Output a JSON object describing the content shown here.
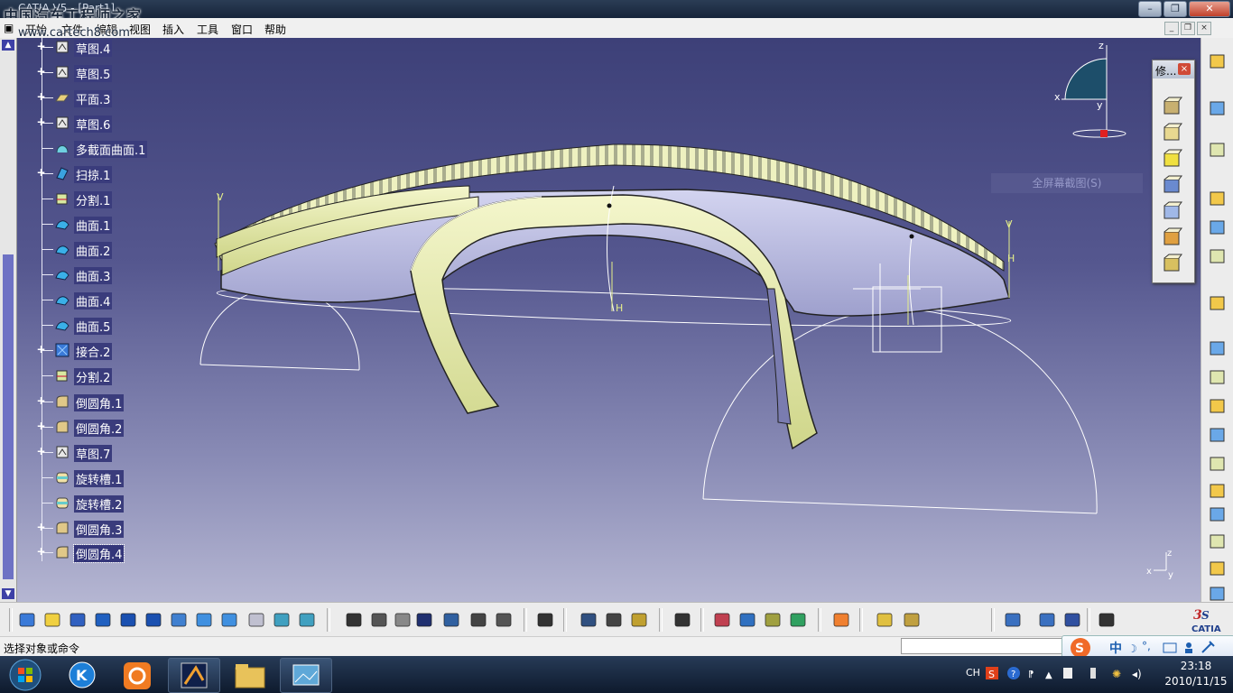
{
  "window": {
    "title": "CATIA V5 - [Part1]",
    "watermark": "中国汽车工程师之家",
    "watermark_url": "www.cartech8.com",
    "controls": [
      "minimize",
      "restore",
      "close"
    ]
  },
  "menubar": {
    "items": [
      "开始",
      "文件",
      "编辑",
      "视图",
      "插入",
      "工具",
      "窗口",
      "帮助"
    ]
  },
  "tree": {
    "items": [
      {
        "label": "草图.4",
        "icon": "sketch-icon",
        "expandable": true
      },
      {
        "label": "草图.5",
        "icon": "sketch-icon",
        "expandable": true
      },
      {
        "label": "平面.3",
        "icon": "plane-icon",
        "expandable": true
      },
      {
        "label": "草图.6",
        "icon": "sketch-icon",
        "expandable": true
      },
      {
        "label": "多截面曲面.1",
        "icon": "multi-section-surface-icon",
        "expandable": false
      },
      {
        "label": "扫掠.1",
        "icon": "sweep-icon",
        "expandable": true
      },
      {
        "label": "分割.1",
        "icon": "split-icon",
        "expandable": false
      },
      {
        "label": "曲面.1",
        "icon": "surface-icon",
        "expandable": false
      },
      {
        "label": "曲面.2",
        "icon": "surface-icon",
        "expandable": false
      },
      {
        "label": "曲面.3",
        "icon": "surface-icon",
        "expandable": false
      },
      {
        "label": "曲面.4",
        "icon": "surface-icon",
        "expandable": false
      },
      {
        "label": "曲面.5",
        "icon": "surface-icon",
        "expandable": false
      },
      {
        "label": "接合.2",
        "icon": "join-icon",
        "expandable": true
      },
      {
        "label": "分割.2",
        "icon": "split-icon",
        "expandable": false
      },
      {
        "label": "倒圆角.1",
        "icon": "fillet-icon",
        "expandable": true
      },
      {
        "label": "倒圆角.2",
        "icon": "fillet-icon",
        "expandable": true
      },
      {
        "label": "草图.7",
        "icon": "sketch-icon",
        "expandable": true
      },
      {
        "label": "旋转槽.1",
        "icon": "groove-icon",
        "expandable": false
      },
      {
        "label": "旋转槽.2",
        "icon": "groove-icon",
        "expandable": false
      },
      {
        "label": "倒圆角.3",
        "icon": "fillet-icon",
        "expandable": true
      },
      {
        "label": "倒圆角.4",
        "icon": "fillet-icon",
        "expandable": true,
        "selected": true
      }
    ]
  },
  "floating_toolbar": {
    "title": "修...",
    "tools": [
      "draft-icon",
      "shell-icon",
      "thickness-icon",
      "thread-icon",
      "remove-face-icon",
      "replace-face-icon",
      "thickness-surface-icon"
    ]
  },
  "viewport": {
    "compass_labels": {
      "z": "z",
      "x": "x",
      "y": "y"
    },
    "axis_labels": {
      "z": "z",
      "x": "x",
      "y": "y"
    },
    "screen_capture_hint": "全屏幕截图(S)",
    "dimension_labels": [
      "H",
      "V",
      "H",
      "V"
    ]
  },
  "bottom_toolbar": {
    "tools": [
      "fly-mode-icon",
      "fit-all-icon",
      "pan-icon",
      "rotate-icon",
      "zoom-in-icon",
      "zoom-out-icon",
      "normal-view-icon",
      "multi-view-icon",
      "iso-view-icon",
      "shading-icon",
      "hide-show-icon",
      "swap-space-icon",
      "formula-icon",
      "comment-icon",
      "reference-icon",
      "table-icon",
      "knowledge-icon",
      "catalog-icon",
      "expose-icon",
      "update-icon",
      "measure-icon",
      "inertia-icon",
      "material-icon",
      "capture-icon",
      "apply-material-icon",
      "texture-icon",
      "environment-icon",
      "layer-icon",
      "paint-icon",
      "axis-icon",
      "sketch-icon",
      "plane-icon",
      "analysis-icon",
      "grid-icon",
      "snap-icon"
    ]
  },
  "statusbar": {
    "status_text": "选择对象或命令",
    "command_input": ""
  },
  "ime": {
    "mode": "中",
    "items": [
      "sogou-icon",
      "moon-icon",
      "punctuation-icon",
      "keyboard-icon",
      "user-icon",
      "wrench-icon"
    ]
  },
  "taskbar": {
    "tray_lang": "CH",
    "time": "23:18",
    "date": "2010/11/15"
  },
  "brand": {
    "logo": "CATIA"
  },
  "colors": {
    "viewport_top": "#3d4078",
    "viewport_bottom": "#b5b6d2",
    "surface_yellow": "#e8edb0",
    "surface_lavender": "#b9bbe0",
    "tree_label_bg": "#3a3c7c"
  }
}
